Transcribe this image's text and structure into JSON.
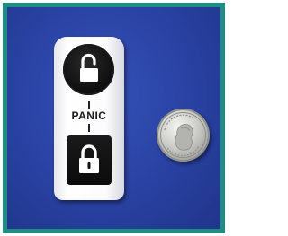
{
  "photo": {
    "border_color": "#1b8f82",
    "background_color": "#2b44a6"
  },
  "device": {
    "name": "panic-button-keyfob",
    "top_button_icon": "unlocked-padlock-icon",
    "label": "PANIC",
    "bottom_button_icon": "locked-padlock-icon"
  },
  "coin": {
    "type": "quarter-dollar"
  }
}
